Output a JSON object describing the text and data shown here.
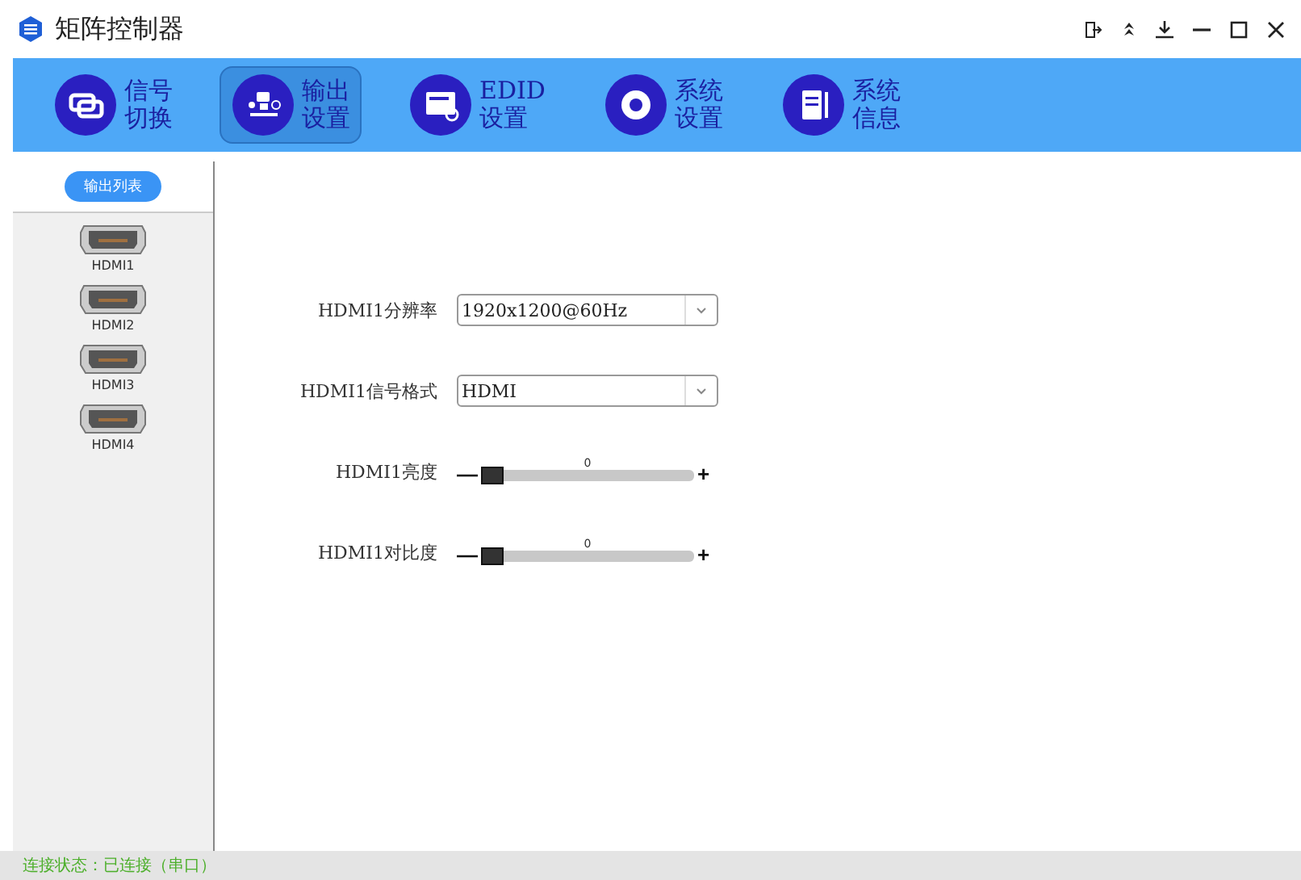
{
  "window": {
    "title": "矩阵控制器"
  },
  "toolbar": [
    {
      "kind": "switch",
      "line1": "信号",
      "line2": "切换",
      "selected": false
    },
    {
      "kind": "output",
      "line1": "输出",
      "line2": "设置",
      "selected": true
    },
    {
      "kind": "edid",
      "line1": "EDID",
      "line2": "设置",
      "selected": false
    },
    {
      "kind": "gear",
      "line1": "系统",
      "line2": "设置",
      "selected": false
    },
    {
      "kind": "info",
      "line1": "系统",
      "line2": "信息",
      "selected": false
    }
  ],
  "sidebar": {
    "header": "输出列表",
    "items": [
      {
        "label": "HDMI1"
      },
      {
        "label": "HDMI2"
      },
      {
        "label": "HDMI3"
      },
      {
        "label": "HDMI4"
      }
    ]
  },
  "settings": [
    {
      "kind": "select",
      "label": "HDMI1分辨率",
      "value": "1920x1200@60Hz"
    },
    {
      "kind": "select",
      "label": "HDMI1信号格式",
      "value": "HDMI"
    },
    {
      "kind": "slider",
      "label": "HDMI1亮度",
      "reading": "0",
      "level": 0,
      "minus": "—",
      "plus": "+"
    },
    {
      "kind": "slider",
      "label": "HDMI1对比度",
      "reading": "0",
      "level": 0,
      "minus": "—",
      "plus": "+"
    }
  ],
  "status_bar": "连接状态：已连接（串口）"
}
